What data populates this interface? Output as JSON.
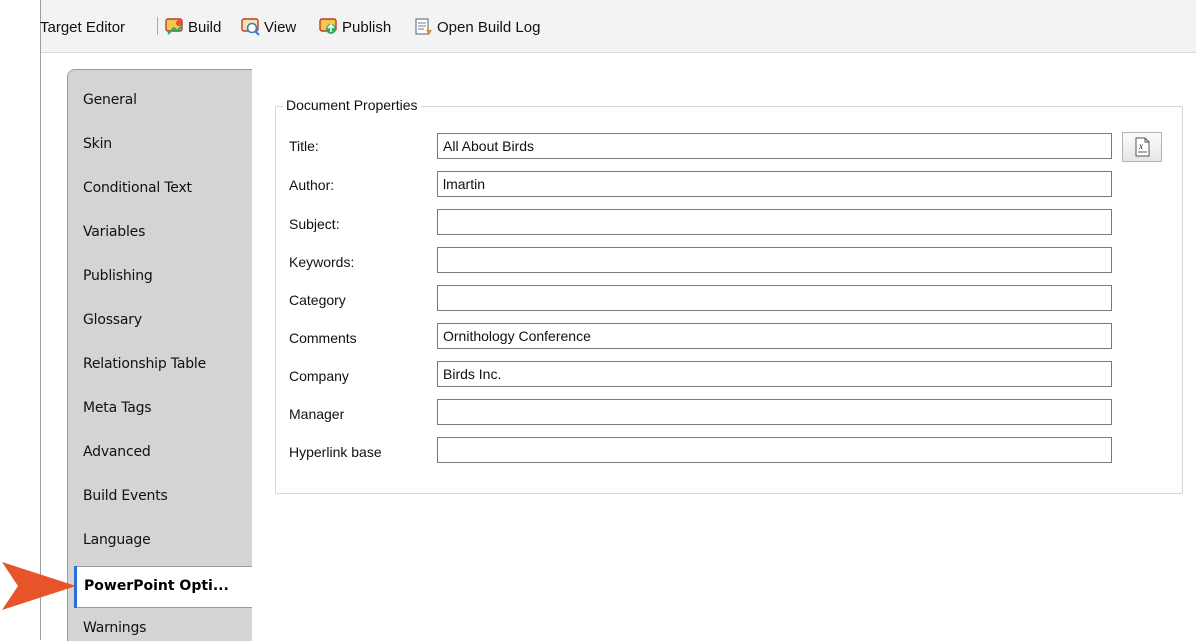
{
  "toolbar": {
    "title": "Target Editor",
    "build_label": "Build",
    "view_label": "View",
    "publish_label": "Publish",
    "open_log_label": "Open Build Log"
  },
  "tabs": [
    {
      "label": "General"
    },
    {
      "label": "Skin"
    },
    {
      "label": "Conditional Text"
    },
    {
      "label": "Variables"
    },
    {
      "label": "Publishing"
    },
    {
      "label": "Glossary"
    },
    {
      "label": "Relationship Table"
    },
    {
      "label": "Meta Tags"
    },
    {
      "label": "Advanced"
    },
    {
      "label": "Build Events"
    },
    {
      "label": "Language"
    },
    {
      "label": "PowerPoint Opti..."
    },
    {
      "label": "Warnings"
    }
  ],
  "active_tab": "PowerPoint Opti...",
  "document_properties": {
    "legend": "Document Properties",
    "fields": [
      {
        "label": "Title:",
        "value": "All About Birds"
      },
      {
        "label": "Author:",
        "value": "lmartin"
      },
      {
        "label": "Subject:",
        "value": ""
      },
      {
        "label": "Keywords:",
        "value": ""
      },
      {
        "label": "Category",
        "value": ""
      },
      {
        "label": "Comments",
        "value": "Ornithology Conference"
      },
      {
        "label": "Company",
        "value": "Birds Inc."
      },
      {
        "label": "Manager",
        "value": ""
      },
      {
        "label": "Hyperlink base",
        "value": ""
      }
    ]
  },
  "colors": {
    "accent_arrow": "#e8542a",
    "active_tab_accent": "#2a6fd6",
    "tab_background": "#d4d4d4"
  }
}
